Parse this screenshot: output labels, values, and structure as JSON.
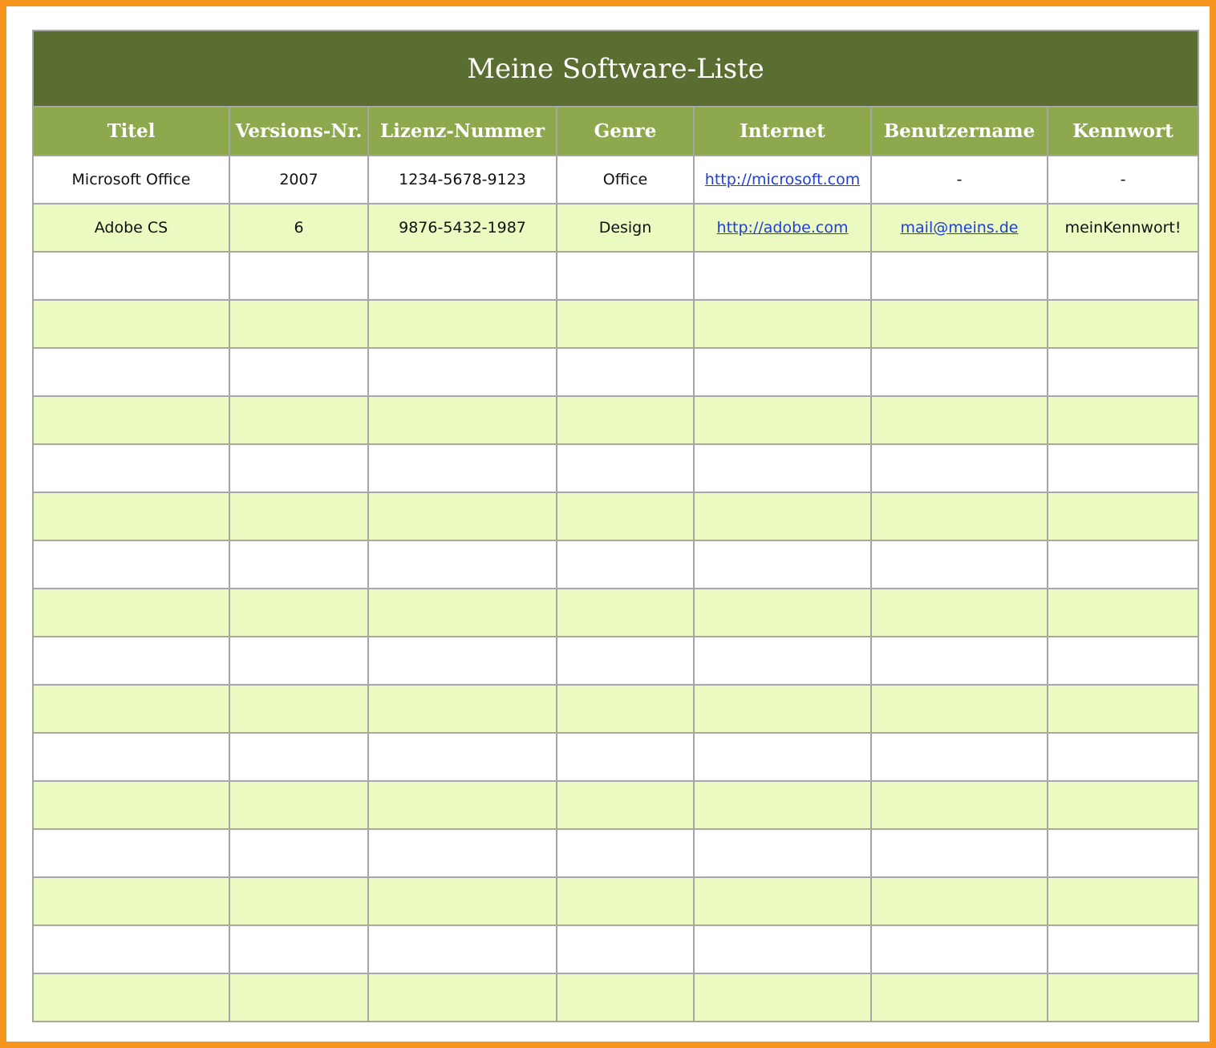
{
  "title": "Meine Software-Liste",
  "columns": [
    "Titel",
    "Versions-Nr.",
    "Lizenz-Nummer",
    "Genre",
    "Internet",
    "Benutzername",
    "Kennwort"
  ],
  "rows": [
    {
      "titel": "Microsoft Office",
      "version": "2007",
      "lizenz": "1234-5678-9123",
      "genre": "Office",
      "internet": "http://microsoft.com",
      "benutzername": "-",
      "kennwort": "-"
    },
    {
      "titel": "Adobe CS",
      "version": "6",
      "lizenz": "9876-5432-1987",
      "genre": "Design",
      "internet": "http://adobe.com",
      "benutzername": "mail@meins.de",
      "kennwort": "meinKennwort!"
    }
  ],
  "empty_row_count": 16,
  "colors": {
    "frame_border": "#f7941d",
    "title_background": "#5b6e31",
    "header_background": "#8ea94d",
    "row_green": "#ebfac0",
    "row_white": "#ffffff",
    "link": "#1f3fd6"
  }
}
